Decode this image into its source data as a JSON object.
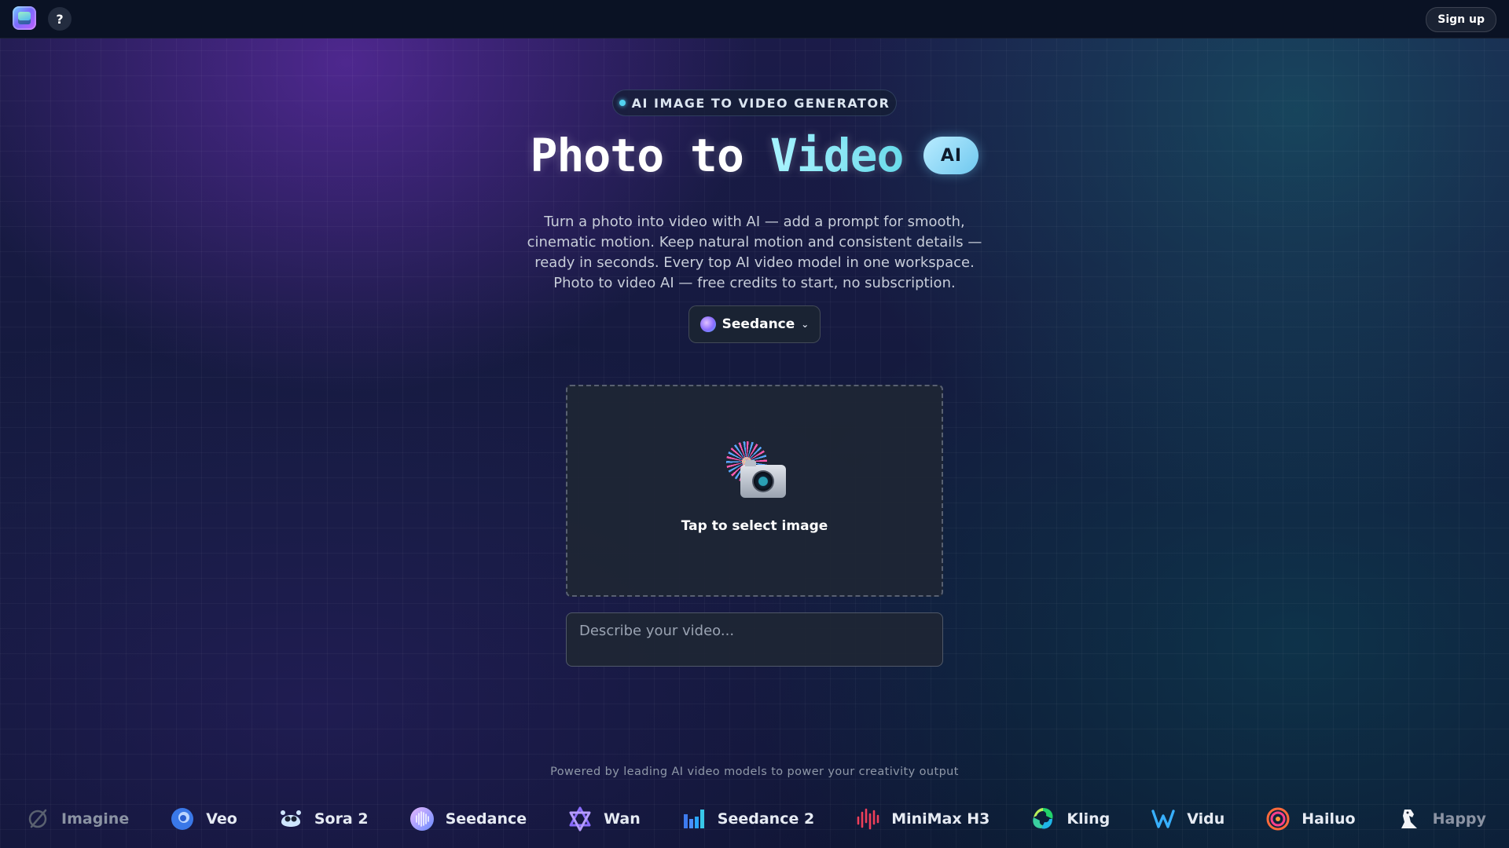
{
  "topbar": {
    "help_label": "?",
    "signup_label": "Sign up"
  },
  "hero": {
    "badge": "AI IMAGE TO VIDEO GENERATOR",
    "title_main": "Photo to ",
    "title_accent": "Video",
    "ai_pill": "AI",
    "description": "Turn a photo into video with AI — add a prompt for smooth, cinematic motion. Keep natural motion and consistent details — ready in seconds. Every top AI video model in one workspace. Photo to video AI — free credits to start, no subscription."
  },
  "model_select": {
    "selected": "Seedance",
    "icon": "seedance-orb-icon"
  },
  "upload": {
    "icon": "camera-with-fireworks-icon",
    "label": "Tap to select image"
  },
  "prompt": {
    "placeholder": "Describe your video...",
    "value": ""
  },
  "footer": {
    "powered_text": "Powered by leading AI video models to power your creativity output",
    "models": [
      {
        "name": "Imagine",
        "icon": "imagine-icon"
      },
      {
        "name": "Veo",
        "icon": "veo-icon"
      },
      {
        "name": "Sora 2",
        "icon": "sora-icon"
      },
      {
        "name": "Seedance",
        "icon": "seedance-icon"
      },
      {
        "name": "Wan",
        "icon": "wan-icon"
      },
      {
        "name": "Seedance 2",
        "icon": "seedance-bars-icon"
      },
      {
        "name": "MiniMax H3",
        "icon": "minimax-wave-icon"
      },
      {
        "name": "Kling",
        "icon": "kling-icon"
      },
      {
        "name": "Vidu",
        "icon": "vidu-icon"
      },
      {
        "name": "Hailuo",
        "icon": "hailuo-icon"
      },
      {
        "name": "Happy Horse",
        "icon": "horse-icon"
      }
    ]
  },
  "colors": {
    "accent_cyan": "#52d3f0",
    "background": "#0f1830",
    "panel": "#1e2634"
  }
}
